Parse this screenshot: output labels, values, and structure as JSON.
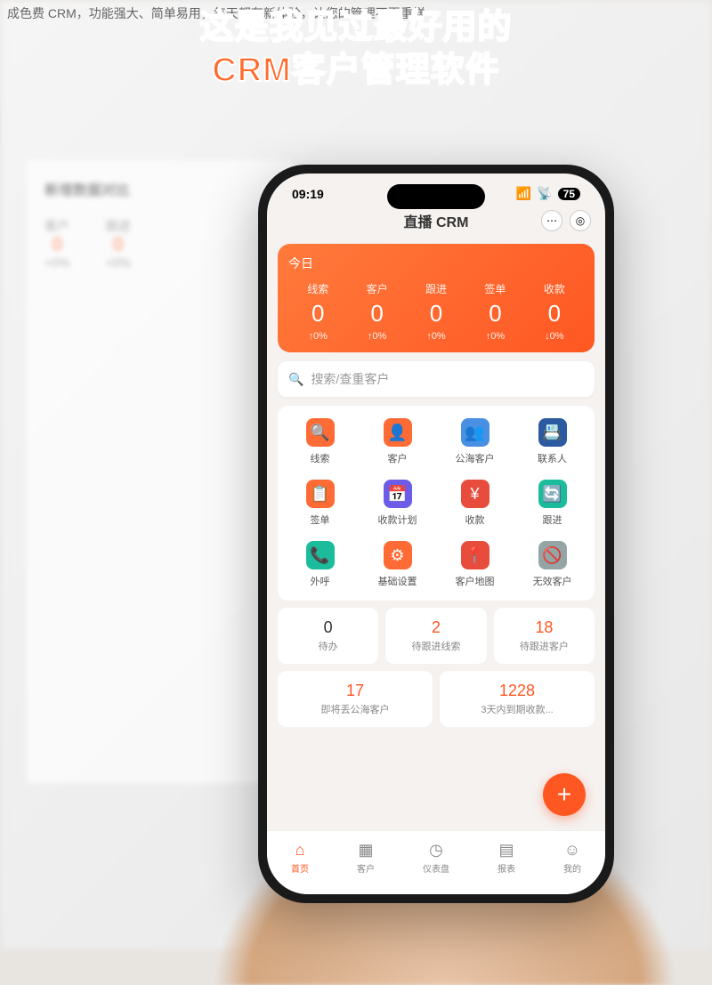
{
  "tagline": "成色费 CRM，功能强大、简单易用，每天都有新体验，让您的管理不再重样",
  "caption": "这是我见过最好用的\nCRM客户管理软件",
  "statusBar": {
    "time": "09:19",
    "battery": "75"
  },
  "appTitle": "直播 CRM",
  "today": {
    "label": "今日",
    "stats": [
      {
        "name": "线索",
        "value": "0",
        "delta": "↑0%"
      },
      {
        "name": "客户",
        "value": "0",
        "delta": "↑0%"
      },
      {
        "name": "跟进",
        "value": "0",
        "delta": "↑0%"
      },
      {
        "name": "签单",
        "value": "0",
        "delta": "↑0%"
      },
      {
        "name": "收款",
        "value": "0",
        "delta": "↓0%"
      }
    ]
  },
  "search": {
    "placeholder": "搜索/查重客户"
  },
  "gridItems": [
    {
      "label": "线索",
      "icon": "🔍",
      "color": "c-orange"
    },
    {
      "label": "客户",
      "icon": "👤",
      "color": "c-orange"
    },
    {
      "label": "公海客户",
      "icon": "👥",
      "color": "c-blue"
    },
    {
      "label": "联系人",
      "icon": "📇",
      "color": "c-navy"
    },
    {
      "label": "签单",
      "icon": "📋",
      "color": "c-orange"
    },
    {
      "label": "收款计划",
      "icon": "📅",
      "color": "c-purple"
    },
    {
      "label": "收款",
      "icon": "¥",
      "color": "c-red"
    },
    {
      "label": "跟进",
      "icon": "🔄",
      "color": "c-teal"
    },
    {
      "label": "外呼",
      "icon": "📞",
      "color": "c-teal"
    },
    {
      "label": "基础设置",
      "icon": "⚙",
      "color": "c-orange"
    },
    {
      "label": "客户地图",
      "icon": "📍",
      "color": "c-red"
    },
    {
      "label": "无效客户",
      "icon": "🚫",
      "color": "c-gray"
    }
  ],
  "tilesRow1": [
    {
      "value": "0",
      "label": "待办",
      "orange": false
    },
    {
      "value": "2",
      "label": "待跟进线索",
      "orange": true
    },
    {
      "value": "18",
      "label": "待跟进客户",
      "orange": true
    }
  ],
  "tilesRow2": [
    {
      "value": "17",
      "label": "即将丢公海客户",
      "orange": true
    },
    {
      "value": "1228",
      "label": "3天内到期收款...",
      "orange": true
    }
  ],
  "fab": "+",
  "nav": [
    {
      "label": "首页",
      "icon": "⌂",
      "active": true
    },
    {
      "label": "客户",
      "icon": "▦",
      "active": false
    },
    {
      "label": "仪表盘",
      "icon": "◷",
      "active": false
    },
    {
      "label": "报表",
      "icon": "▤",
      "active": false
    },
    {
      "label": "我的",
      "icon": "☺",
      "active": false
    }
  ],
  "desktop": {
    "header": "新增数据对比",
    "cols": [
      "客户",
      "跟进"
    ],
    "vals": [
      "0",
      "0"
    ],
    "deltas": [
      "+0%",
      "+0%"
    ]
  }
}
